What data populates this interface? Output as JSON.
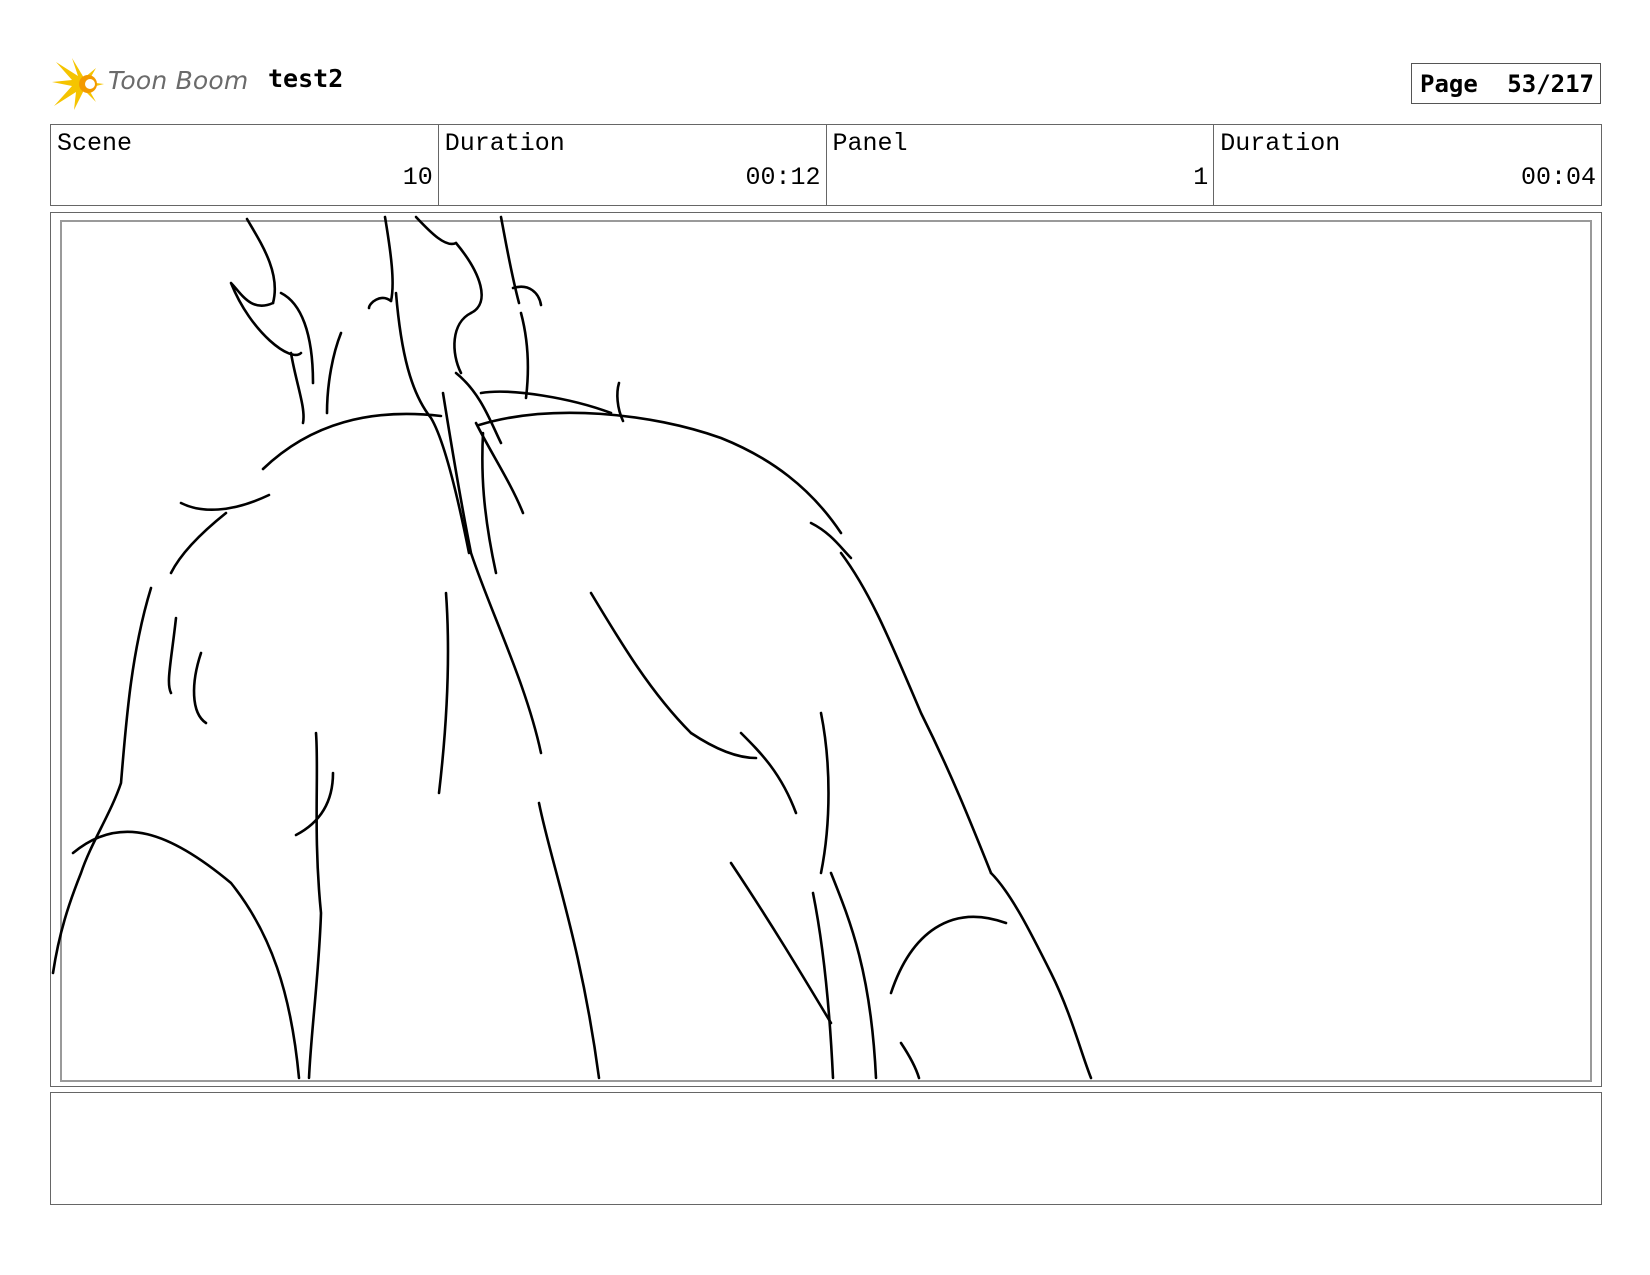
{
  "header": {
    "logo_text": "Toon Boom",
    "project_title": "test2",
    "page_label": "Page",
    "page_value": "53/217"
  },
  "info": {
    "scene_label": "Scene",
    "scene_value": "10",
    "scene_duration_label": "Duration",
    "scene_duration_value": "00:12",
    "panel_label": "Panel",
    "panel_value": "1",
    "panel_duration_label": "Duration",
    "panel_duration_value": "00:04"
  },
  "colors": {
    "logo_yellow": "#f5c400",
    "logo_orange": "#f39a00",
    "frame_gray": "#9a9a9a"
  },
  "icons": {
    "logo": "toon-boom-starburst-icon"
  }
}
